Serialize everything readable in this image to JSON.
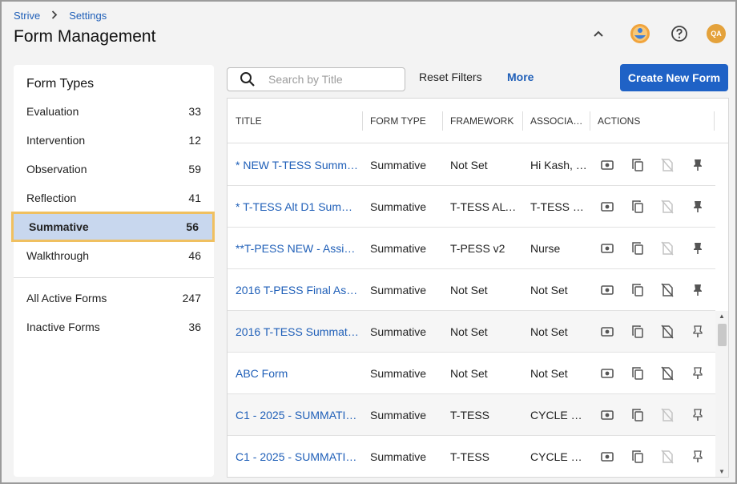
{
  "breadcrumb": {
    "root": "Strive",
    "current": "Settings"
  },
  "page_title": "Form Management",
  "header": {
    "avatar_initials": "QA"
  },
  "sidebar": {
    "title": "Form Types",
    "items": [
      {
        "label": "Evaluation",
        "count": "33"
      },
      {
        "label": "Intervention",
        "count": "12"
      },
      {
        "label": "Observation",
        "count": "59"
      },
      {
        "label": "Reflection",
        "count": "41"
      },
      {
        "label": "Summative",
        "count": "56",
        "active": true
      },
      {
        "label": "Walkthrough",
        "count": "46"
      }
    ],
    "extra": [
      {
        "label": "All Active Forms",
        "count": "247"
      },
      {
        "label": "Inactive Forms",
        "count": "36"
      }
    ]
  },
  "toolbar": {
    "search_placeholder": "Search by Title",
    "reset_label": "Reset Filters",
    "more_label": "More",
    "create_label": "Create New Form"
  },
  "table": {
    "columns": [
      "TITLE",
      "FORM TYPE",
      "FRAMEWORK",
      "ASSOCIA…",
      "ACTIONS"
    ],
    "rows": [
      {
        "title": "* NEW T-TESS Summa…",
        "form_type": "Summative",
        "framework": "Not Set",
        "associated": "Hi Kash, …",
        "copy_disabled_faded": true,
        "pinned": true
      },
      {
        "title": "* T-TESS Alt D1 Summ…",
        "form_type": "Summative",
        "framework": "T-TESS ALT…",
        "associated": "T-TESS …",
        "copy_disabled_faded": true,
        "pinned": true
      },
      {
        "title": "**T-PESS NEW - Assis…",
        "form_type": "Summative",
        "framework": "T-PESS v2",
        "associated": "Nurse",
        "copy_disabled_faded": true,
        "pinned": true
      },
      {
        "title": "2016 T-PESS Final As…",
        "form_type": "Summative",
        "framework": "Not Set",
        "associated": "Not Set",
        "copy_disabled_faded": false,
        "pinned": true
      },
      {
        "title": "2016 T-TESS Summati…",
        "form_type": "Summative",
        "framework": "Not Set",
        "associated": "Not Set",
        "copy_disabled_faded": false,
        "pinned": false
      },
      {
        "title": "ABC Form",
        "form_type": "Summative",
        "framework": "Not Set",
        "associated": "Not Set",
        "copy_disabled_faded": false,
        "pinned": false
      },
      {
        "title": "C1 - 2025 - SUMMATI…",
        "form_type": "Summative",
        "framework": "T-TESS",
        "associated": "CYCLE 1…",
        "copy_disabled_faded": true,
        "pinned": false
      },
      {
        "title": "C1 - 2025 - SUMMATI…",
        "form_type": "Summative",
        "framework": "T-TESS",
        "associated": "CYCLE 1…",
        "copy_disabled_faded": true,
        "pinned": false
      }
    ]
  },
  "colors": {
    "accent": "#1f62c6",
    "link": "#1f5fb8",
    "active_bg": "#c8d7ee",
    "active_border": "#f0c060"
  }
}
